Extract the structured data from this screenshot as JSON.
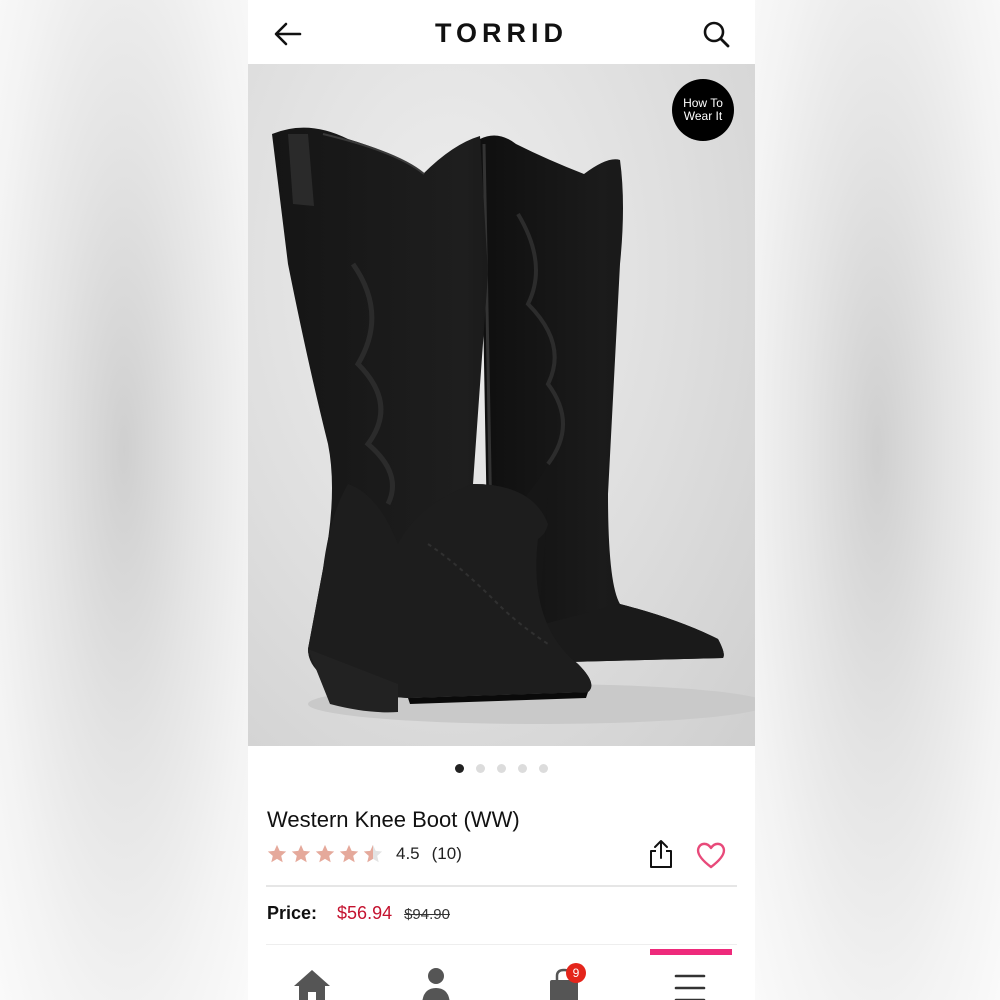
{
  "header": {
    "brand": "TORRID",
    "back_icon": "arrow-left-icon",
    "search_icon": "search-icon"
  },
  "hero": {
    "badge_line1": "How To",
    "badge_line2": "Wear It",
    "image_pages": 5,
    "active_page": 1
  },
  "product": {
    "title": "Western Knee Boot (WW)",
    "rating_value": "4.5",
    "rating_count": "(10)",
    "rating_stars": 4.5,
    "price_label": "Price:",
    "sale_price": "$56.94",
    "original_price": "$94.90"
  },
  "bottom_nav": {
    "items": [
      "home-icon",
      "account-icon",
      "cart-icon",
      "menu-icon"
    ],
    "cart_count": "9"
  },
  "colors": {
    "sale_red": "#c4122f",
    "heart_pink": "#e84a7a",
    "star_color": "#e5a99b",
    "promo_pink": "#ee2a7b",
    "cart_badge": "#e4251b"
  }
}
